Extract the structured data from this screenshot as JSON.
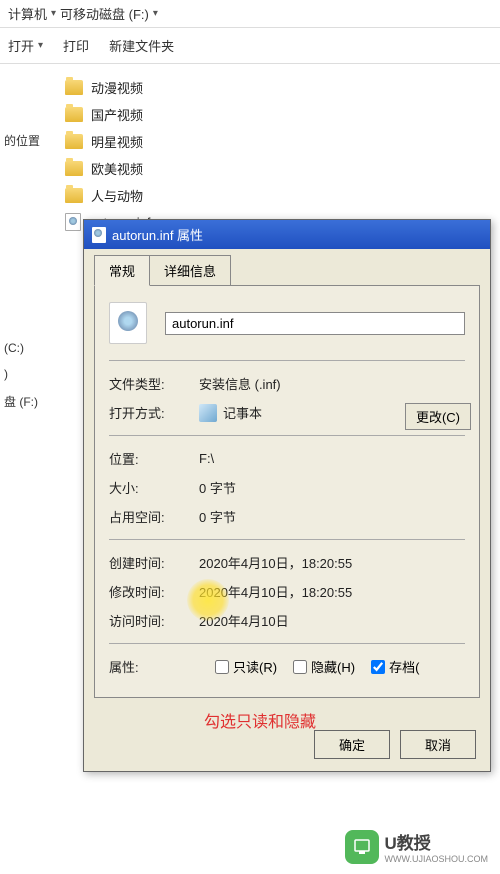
{
  "breadcrumb": {
    "computer": "计算机",
    "drive": "可移动磁盘 (F:)"
  },
  "toolbar": {
    "open": "打开",
    "print": "打印",
    "new_folder": "新建文件夹"
  },
  "sidebar": {
    "location": "的位置",
    "drive_c": "(C:)",
    "drive_c2": ")",
    "disk_f": "盘 (F:)"
  },
  "files": [
    {
      "name": "动漫视频",
      "type": "folder"
    },
    {
      "name": "国产视频",
      "type": "folder"
    },
    {
      "name": "明星视频",
      "type": "folder"
    },
    {
      "name": "欧美视频",
      "type": "folder"
    },
    {
      "name": "人与动物",
      "type": "folder"
    },
    {
      "name": "autorun.inf",
      "type": "file"
    }
  ],
  "dialog": {
    "title": "autorun.inf 属性",
    "tabs": {
      "general": "常规",
      "details": "详细信息"
    },
    "filename": "autorun.inf",
    "rows": {
      "filetype_label": "文件类型:",
      "filetype_value": "安装信息 (.inf)",
      "openwith_label": "打开方式:",
      "openwith_value": "记事本",
      "change_btn": "更改(C)",
      "location_label": "位置:",
      "location_value": "F:\\",
      "size_label": "大小:",
      "size_value": "0 字节",
      "sizeondisk_label": "占用空间:",
      "sizeondisk_value": "0 字节",
      "created_label": "创建时间:",
      "created_value": "2020年4月10日，18:20:55",
      "modified_label": "修改时间:",
      "modified_value": "2020年4月10日，18:20:55",
      "accessed_label": "访问时间:",
      "accessed_value": "2020年4月10日",
      "attributes_label": "属性:",
      "readonly": "只读(R)",
      "hidden": "隐藏(H)",
      "archive": "存档("
    },
    "buttons": {
      "ok": "确定",
      "cancel": "取消"
    }
  },
  "annotation": "勾选只读和隐藏",
  "watermark": {
    "brand": "U教授",
    "url": "WWW.UJIAOSHOU.COM"
  }
}
